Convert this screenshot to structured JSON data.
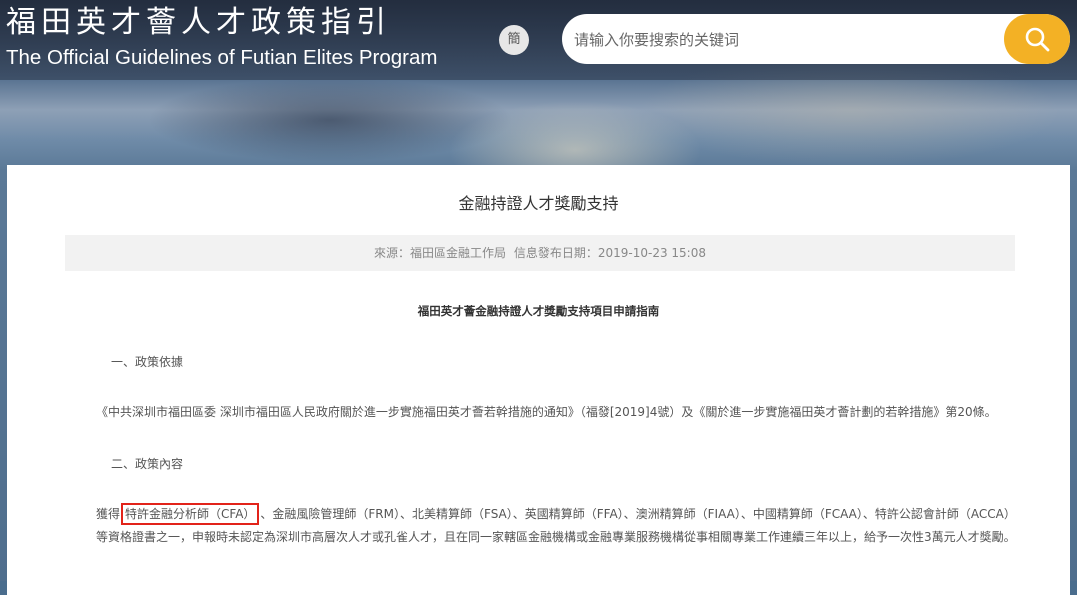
{
  "header": {
    "site_title_cn": "福田英才薈人才政策指引",
    "site_title_en": "The Official Guidelines of Futian Elites Program",
    "lang_toggle_label": "簡",
    "search_placeholder": "请输入你要搜索的关键词",
    "search_icon": "search-icon",
    "accent_color": "#f3b125"
  },
  "article": {
    "title": "金融持證人才獎勵支持",
    "source_label": "來源：福田區金融工作局",
    "date_label": "信息發布日期：2019-10-23 15:08",
    "section_title": "福田英才薈金融持證人才獎勵支持項目申請指南",
    "heading_1": "一、政策依據",
    "basis_text": "《中共深圳市福田區委 深圳市福田區人民政府關於進一步實施福田英才薈若幹措施的通知》（福發[2019]4號）及《關於進一步實施福田英才薈計劃的若幹措施》第20條。",
    "heading_2": "二、政策內容",
    "content_prefix": "獲得",
    "content_highlight": "特許金融分析師（CFA）",
    "content_rest": "、金融風險管理師（FRM）、北美精算師（FSA）、英國精算師（FFA）、澳洲精算師（FIAA）、中國精算師（FCAA）、特許公認會計師（ACCA）等資格證書之一，申報時未認定為深圳市高層次人才或孔雀人才，且在同一家轄區金融機構或金融專業服務機構從事相關專業工作連續三年以上，給予一次性3萬元人才獎勵。",
    "highlight_color": "#e2231a"
  }
}
